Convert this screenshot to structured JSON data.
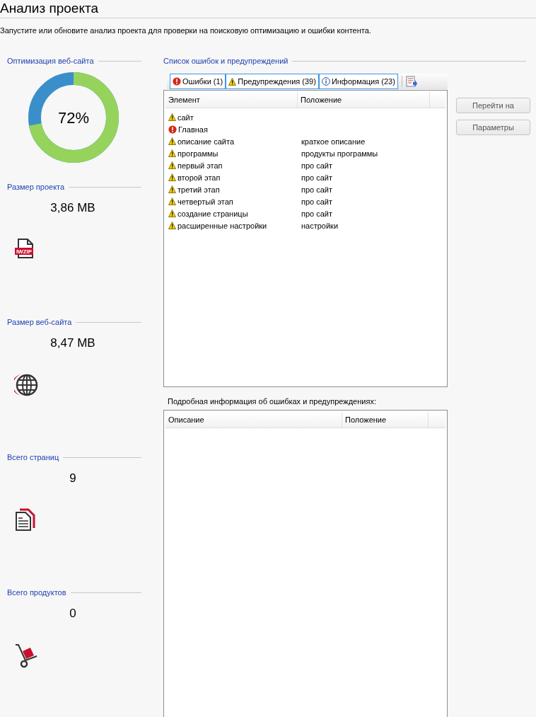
{
  "title": "Анализ проекта",
  "description": "Запустите или обновите анализ проекта для проверки на поисковую оптимизацию и ошибки контента.",
  "optimization": {
    "heading": "Оптимизация веб-сайта",
    "level": 0.72,
    "reading": "72%"
  },
  "stats": [
    {
      "heading": "Размер проекта",
      "value": "3,86 MB",
      "kind": "zip",
      "icon_label": "IWZIP"
    },
    {
      "heading": "Размер веб-сайта",
      "value": "8,47 MB",
      "kind": "globe"
    },
    {
      "heading": "Всего страниц",
      "value": "9",
      "kind": "pages"
    },
    {
      "heading": "Всего продуктов",
      "value": "0",
      "kind": "cart"
    }
  ],
  "issues": {
    "heading": "Список ошибок и предупреждений",
    "filters": [
      {
        "kind": "error",
        "label": "Ошибки (1)",
        "selected": true
      },
      {
        "kind": "warning",
        "label": "Предупреждения (39)",
        "selected": true
      },
      {
        "kind": "info",
        "label": "Информация (23)",
        "selected": true
      }
    ],
    "columns": [
      "Элемент",
      "Положение"
    ],
    "rows": [
      {
        "kind": "warning",
        "element": "сайт"
      },
      {
        "kind": "error",
        "element": "Главная"
      },
      {
        "kind": "warning",
        "element": "описание сайта",
        "location": "краткое описание"
      },
      {
        "kind": "warning",
        "element": "программы",
        "location": "продукты программы"
      },
      {
        "kind": "warning",
        "element": "первый этап",
        "location": "про сайт"
      },
      {
        "kind": "warning",
        "element": "второй этап",
        "location": "про сайт"
      },
      {
        "kind": "warning",
        "element": "третий этап",
        "location": "про сайт"
      },
      {
        "kind": "warning",
        "element": "четвертый этап",
        "location": "про сайт"
      },
      {
        "kind": "warning",
        "element": "создание страницы",
        "location": "про сайт"
      },
      {
        "kind": "warning",
        "element": "расширенные настройки",
        "location": "настройки"
      }
    ]
  },
  "buttons": [
    "Перейти на",
    "Параметры"
  ],
  "details": {
    "heading": "Подробная информация об ошибках и предупреждениях:",
    "columns": [
      "Описание",
      "Положение"
    ]
  }
}
